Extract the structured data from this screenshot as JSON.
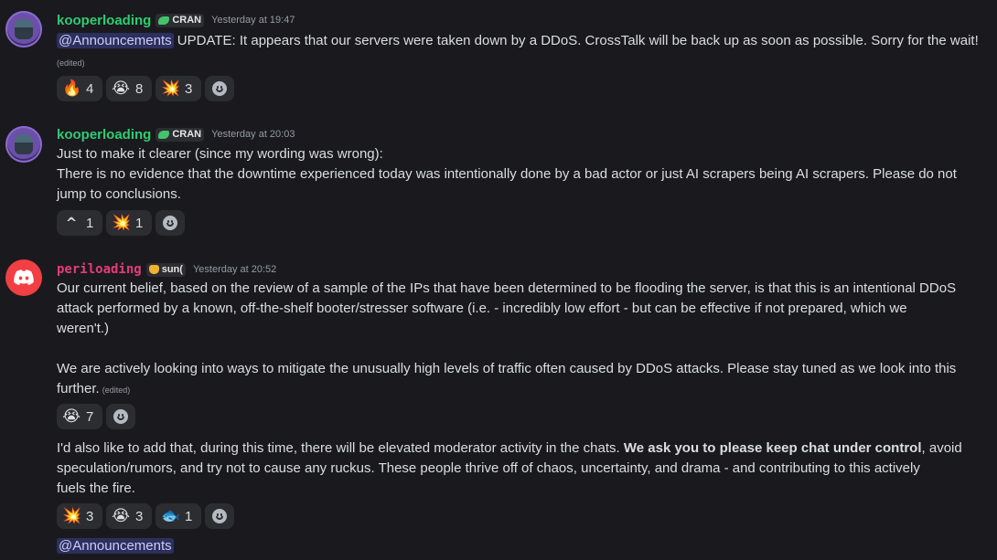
{
  "messages": [
    {
      "author": "kooperloading",
      "tag": "CRAN",
      "timestamp": "Yesterday at 19:47",
      "mention": "@Announcements",
      "text": " UPDATE: It appears that our servers were taken down by a DDoS. CrossTalk will be back up as soon as possible. Sorry for the wait!",
      "edited": "(edited)",
      "reactions": [
        {
          "emoji": "🔥",
          "icon": "fire-icon",
          "count": "4"
        },
        {
          "emoji": "😭",
          "icon": "crying-face-icon",
          "count": "8"
        },
        {
          "emoji": "💥",
          "icon": "collision-icon",
          "count": "3"
        }
      ]
    },
    {
      "author": "kooperloading",
      "tag": "CRAN",
      "timestamp": "Yesterday at 20:03",
      "lines": [
        "Just to make it clearer (since my wording was wrong):",
        "There is no evidence that the downtime experienced today was intentionally done by a bad actor or just AI scrapers being AI scrapers. Please do not",
        "jump to conclusions."
      ],
      "reactions": [
        {
          "emoji": "^",
          "icon": "caret-up-icon",
          "count": "1"
        },
        {
          "emoji": "💥",
          "icon": "collision-icon",
          "count": "1"
        }
      ]
    },
    {
      "author": "periloading",
      "tag": "sun(",
      "timestamp": "Yesterday at 20:52",
      "lines": [
        "Our current belief, based on the review of a sample of the IPs that have been determined to be flooding the server, is that this is an intentional DDoS",
        "attack performed by a known, off-the-shelf booter/stresser software (i.e. - incredibly low effort - but can be effective if not prepared, which we",
        "weren't.)",
        "We are actively looking into ways to mitigate the unusually high levels of traffic often caused by DDoS attacks. Please stay tuned as we look into this",
        "further."
      ],
      "edited": "(edited)",
      "reactions": [
        {
          "emoji": "😭",
          "icon": "crying-face-icon",
          "count": "7"
        }
      ]
    },
    {
      "lines_pre": "I'd also like to add that, during this time, there will be elevated moderator activity in the chats. ",
      "bold": "We ask you to please keep chat under control",
      "lines_post": ", avoid",
      "lines": [
        "speculation/rumors, and try not to cause any ruckus. These people thrive off of chaos, uncertainty, and drama - and contributing to this actively",
        "fuels the fire."
      ],
      "reactions": [
        {
          "emoji": "💥",
          "icon": "collision-icon",
          "count": "3"
        },
        {
          "emoji": "😭",
          "icon": "crying-face-icon",
          "count": "3"
        },
        {
          "emoji": "🐟",
          "icon": "fish-icon",
          "count": "1"
        }
      ],
      "mention": "@Announcements"
    }
  ],
  "colors": {
    "background": "#1a1a1e",
    "koop_name": "#2ecc71",
    "peri_name": "#e63b7a",
    "mention_bg": "#3b3f7a"
  }
}
